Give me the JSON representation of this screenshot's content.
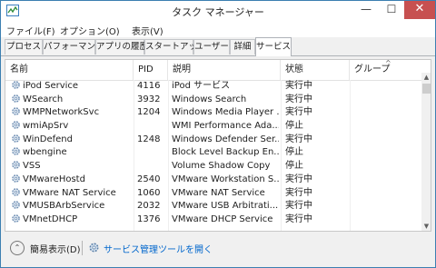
{
  "window": {
    "title": "タスク マネージャー"
  },
  "controls": {
    "minimize": "—",
    "maximize": "☐",
    "close": "✕"
  },
  "menu": [
    "ファイル(F)",
    "オプション(O)",
    "表示(V)"
  ],
  "tabs": [
    "プロセス",
    "パフォーマンス",
    "アプリの履歴",
    "スタートアップ",
    "ユーザー",
    "詳細",
    "サービス"
  ],
  "active_tab": "サービス",
  "columns": {
    "name": "名前",
    "pid": "PID",
    "desc": "説明",
    "state": "状態",
    "group": "グループ"
  },
  "sort_indicator": "^",
  "services": [
    {
      "name": "iPod Service",
      "pid": "4116",
      "desc": "iPod サービス",
      "state": "実行中"
    },
    {
      "name": "WSearch",
      "pid": "3932",
      "desc": "Windows Search",
      "state": "実行中"
    },
    {
      "name": "WMPNetworkSvc",
      "pid": "1204",
      "desc": "Windows Media Player ...",
      "state": "実行中"
    },
    {
      "name": "wmiApSrv",
      "pid": "",
      "desc": "WMI Performance Ada...",
      "state": "停止"
    },
    {
      "name": "WinDefend",
      "pid": "1248",
      "desc": "Windows Defender Ser...",
      "state": "実行中"
    },
    {
      "name": "wbengine",
      "pid": "",
      "desc": "Block Level Backup En...",
      "state": "停止"
    },
    {
      "name": "VSS",
      "pid": "",
      "desc": "Volume Shadow Copy",
      "state": "停止"
    },
    {
      "name": "VMwareHostd",
      "pid": "2540",
      "desc": "VMware Workstation S...",
      "state": "実行中"
    },
    {
      "name": "VMware NAT Service",
      "pid": "1060",
      "desc": "VMware NAT Service",
      "state": "実行中"
    },
    {
      "name": "VMUSBArbService",
      "pid": "2032",
      "desc": "VMware USB Arbitrati...",
      "state": "実行中"
    },
    {
      "name": "VMnetDHCP",
      "pid": "1376",
      "desc": "VMware DHCP Service",
      "state": "実行中"
    }
  ],
  "footer": {
    "fewer_details": "簡易表示(D)",
    "open_services": "サービス管理ツールを開く"
  },
  "colors": {
    "link": "#0066cc",
    "close": "#c75050",
    "border": "#3c7fb1"
  },
  "icons": {
    "app": "task-manager-icon",
    "service": "gear-icon",
    "collapse": "chevron-up-icon"
  }
}
